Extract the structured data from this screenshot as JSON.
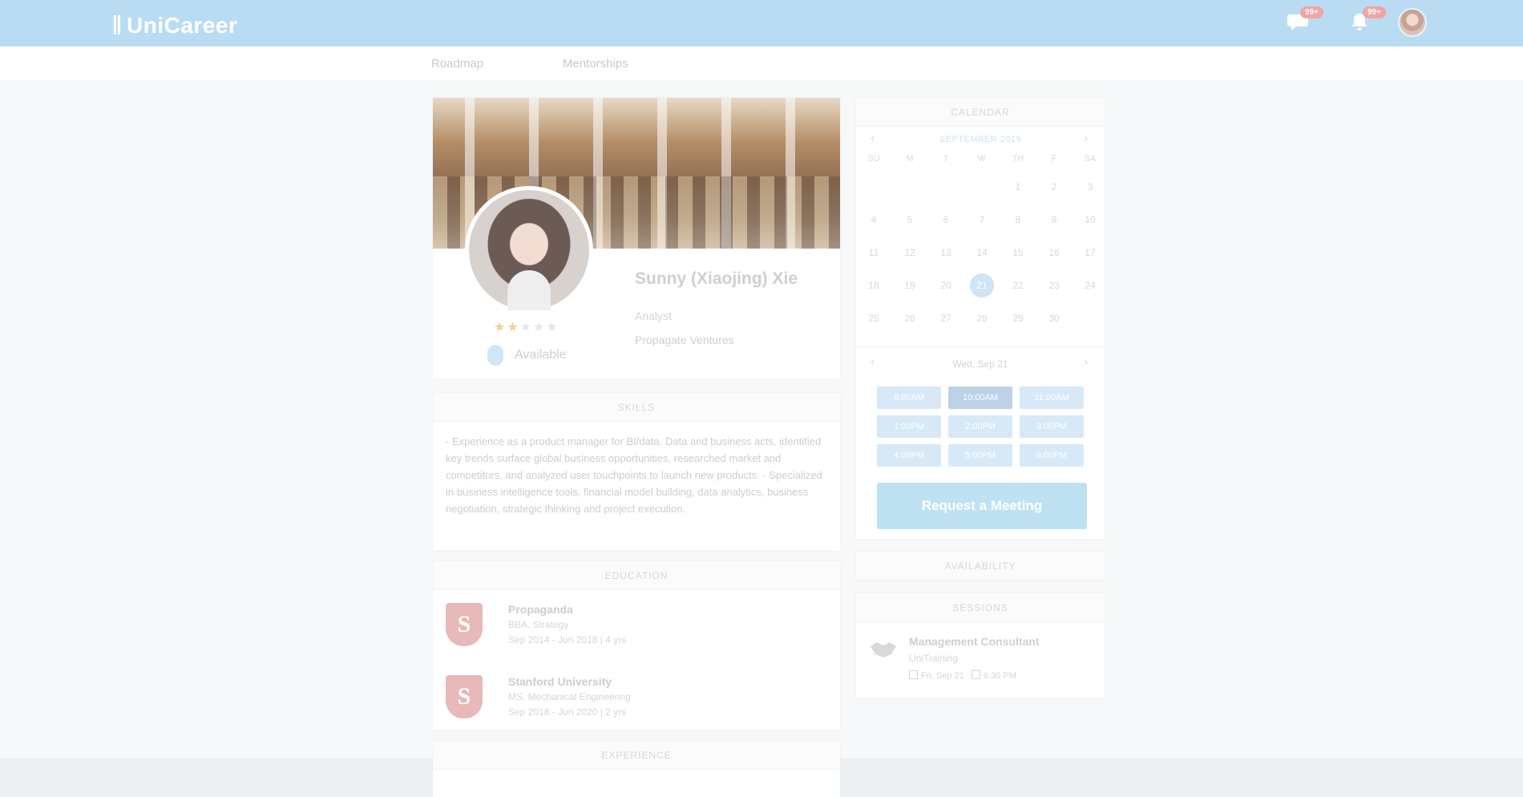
{
  "header": {
    "logo": "UniCareer",
    "messages_badge": "99+",
    "notifications_badge": "99+"
  },
  "subnav": {
    "items": [
      "Roadmap",
      "Mentorships"
    ]
  },
  "profile": {
    "rating": 2,
    "rating_max": 5,
    "stars_on": "★★",
    "stars_off": "★★★",
    "verified_label": "Available",
    "name": "Sunny (Xiaojing) Xie",
    "role": "Analyst",
    "company": "Propagate Ventures"
  },
  "skills": {
    "title": "SKILLS",
    "text": "- Experience as a product manager for BI/data. Data and business acts, identified key trends surface global business opportunities, researched market and competitors, and analyzed user touchpoints to launch new products. - Specialized in business intelligence tools, financial model building, data analytics, business negotiation, strategic thinking and project execution."
  },
  "education": {
    "title": "EDUCATION",
    "items": [
      {
        "logo": "S",
        "name": "Propaganda",
        "degree": "BBA, Strategy",
        "dates": "Sep 2014 - Jun 2018 | 4 yrs"
      },
      {
        "logo": "S",
        "name": "Stanford University",
        "degree": "MS, Mechanical Engineering",
        "dates": "Sep 2018 - Jun 2020 | 2 yrs"
      }
    ]
  },
  "experience": {
    "title": "EXPERIENCE"
  },
  "calendar": {
    "title": "CALENDAR",
    "month": "SEPTEMBER 2019",
    "prev": "‹",
    "next": "›",
    "weekdays": [
      "SU",
      "M",
      "T",
      "W",
      "TH",
      "F",
      "SA"
    ],
    "weeks": [
      [
        "",
        "",
        "",
        "",
        "1",
        "2",
        "3"
      ],
      [
        "4",
        "5",
        "6",
        "7",
        "8",
        "9",
        "10"
      ],
      [
        "11",
        "12",
        "13",
        "14",
        "15",
        "16",
        "17"
      ],
      [
        "18",
        "19",
        "20",
        "21",
        "22",
        "23",
        "24"
      ],
      [
        "25",
        "26",
        "27",
        "28",
        "29",
        "30",
        ""
      ]
    ],
    "today": "21",
    "time_label": "Wed, Sep 21",
    "slots": [
      "9:00AM",
      "10:00AM",
      "11:00AM",
      "1:00PM",
      "2:00PM",
      "3:00PM",
      "4:00PM",
      "5:00PM",
      "6:00PM"
    ],
    "selected_slot": 1,
    "request_button": "Request a Meeting"
  },
  "availability": {
    "title": "AVAILABILITY"
  },
  "sessions": {
    "title": "SESSIONS",
    "item_title": "Management Consultant",
    "item_sub": "UniTraining",
    "item_date": "Fri, Sep 21",
    "item_time": "6:30 PM"
  },
  "colors": {
    "topbar": "#b9dcf3",
    "accent": "#bfe2f3",
    "today": "#cde5f6"
  }
}
